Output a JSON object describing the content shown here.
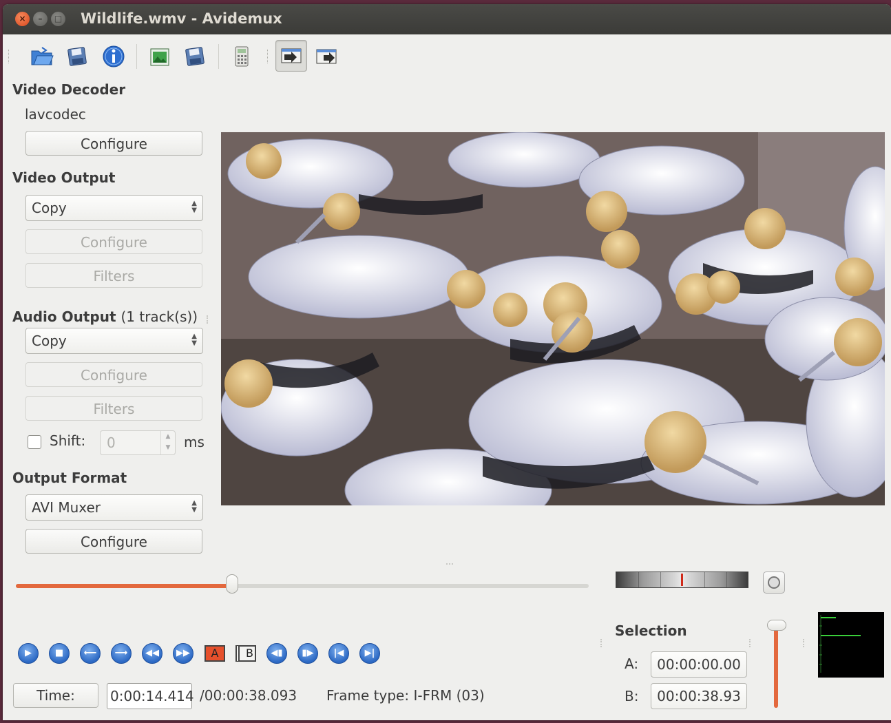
{
  "window": {
    "title": "Wildlife.wmv - Avidemux"
  },
  "toolbar": {
    "icons": [
      "open-video-icon",
      "save-video-icon",
      "info-icon",
      "open-image-icon",
      "save-image-icon",
      "calculator-icon",
      "mode-in-icon",
      "mode-out-icon"
    ]
  },
  "video_decoder": {
    "title": "Video Decoder",
    "codec": "lavcodec",
    "configure": "Configure"
  },
  "video_output": {
    "title": "Video Output",
    "codec": "Copy",
    "configure": "Configure",
    "filters": "Filters"
  },
  "audio_output": {
    "title": "Audio Output",
    "tracks": "(1 track(s))",
    "codec": "Copy",
    "configure": "Configure",
    "filters": "Filters",
    "shift_label": "Shift:",
    "shift_value": "0",
    "shift_unit": "ms"
  },
  "output_format": {
    "title": "Output Format",
    "muxer": "AVI Muxer",
    "configure": "Configure"
  },
  "seek": {
    "position": 0.378
  },
  "playback": {
    "buttons": [
      "play",
      "stop",
      "previous-frame",
      "next-frame",
      "previous-keyframe",
      "next-keyframe",
      "set-marker-a",
      "set-marker-b",
      "previous-black-frame",
      "next-black-frame",
      "go-to-first-frame",
      "go-to-last-frame"
    ],
    "marker_a": "A",
    "marker_b": "B"
  },
  "status": {
    "time_button": "Time:",
    "current_time": "0:00:14.414",
    "duration": "/00:00:38.093",
    "frame_type_label": "Frame type:",
    "frame_type": "I-FRM (03)"
  },
  "selection": {
    "title": "Selection",
    "a_label": "A:",
    "a_value": "00:00:00.00",
    "b_label": "B:",
    "b_value": "00:00:38.93"
  },
  "volume": {
    "level": 1.0
  },
  "colors": {
    "accent": "#e3683d",
    "titlebar": "#3c3b37",
    "window_bg": "#efefed",
    "close_button": "#e0582a",
    "playback_blue": "#2c69c4"
  }
}
